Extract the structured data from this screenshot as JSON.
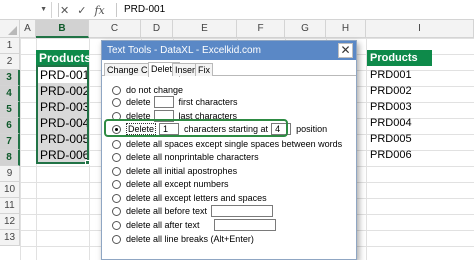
{
  "formula_bar": {
    "name_box": "",
    "cancel_icon": "✕",
    "enter_icon": "✓",
    "fx": "fx",
    "content": "PRD-001"
  },
  "grid": {
    "columns": [
      "A",
      "B",
      "C",
      "D",
      "E",
      "F",
      "G",
      "H",
      "I"
    ],
    "rows": [
      "1",
      "2",
      "3",
      "4",
      "5",
      "6",
      "7",
      "8",
      "9",
      "10",
      "11",
      "12",
      "13"
    ]
  },
  "products_b": {
    "header": "Products",
    "values": [
      "PRD-001",
      "PRD-002",
      "PRD-003",
      "PRD-004",
      "PRD-005",
      "PRD-006"
    ]
  },
  "products_i": {
    "header": "Products",
    "values": [
      "PRD001",
      "PRD002",
      "PRD003",
      "PRD004",
      "PRD005",
      "PRD006"
    ]
  },
  "dialog": {
    "title": "Text Tools - DataXL - Excelkid.com",
    "close_label": "✕",
    "tabs": [
      "Change Case",
      "Delete",
      "Insert",
      "Fix"
    ],
    "active_tab": "Delete",
    "options": {
      "do_not_change": "do not change",
      "delete_first_pre": "delete",
      "delete_first_post": "first characters",
      "delete_last_pre": "delete",
      "delete_last_post": "last characters",
      "delete_pos_btn": "Delete",
      "delete_pos_count": "1",
      "delete_pos_mid": "characters starting at",
      "delete_pos_start": "4",
      "delete_pos_post": "position",
      "spaces": "delete all spaces except single spaces between words",
      "nonprintable": "delete all nonprintable characters",
      "apostrophes": "delete all initial apostrophes",
      "except_numbers": "delete all except numbers",
      "except_letters_spaces": "delete all except letters and spaces",
      "before_text": "delete all before text",
      "after_text": "delete all after text",
      "line_breaks": "delete all line breaks (Alt+Enter)"
    }
  },
  "colors": {
    "accent_green": "#217346",
    "header_fill": "#0e8a4a",
    "dialog_title": "#5a88c6"
  }
}
